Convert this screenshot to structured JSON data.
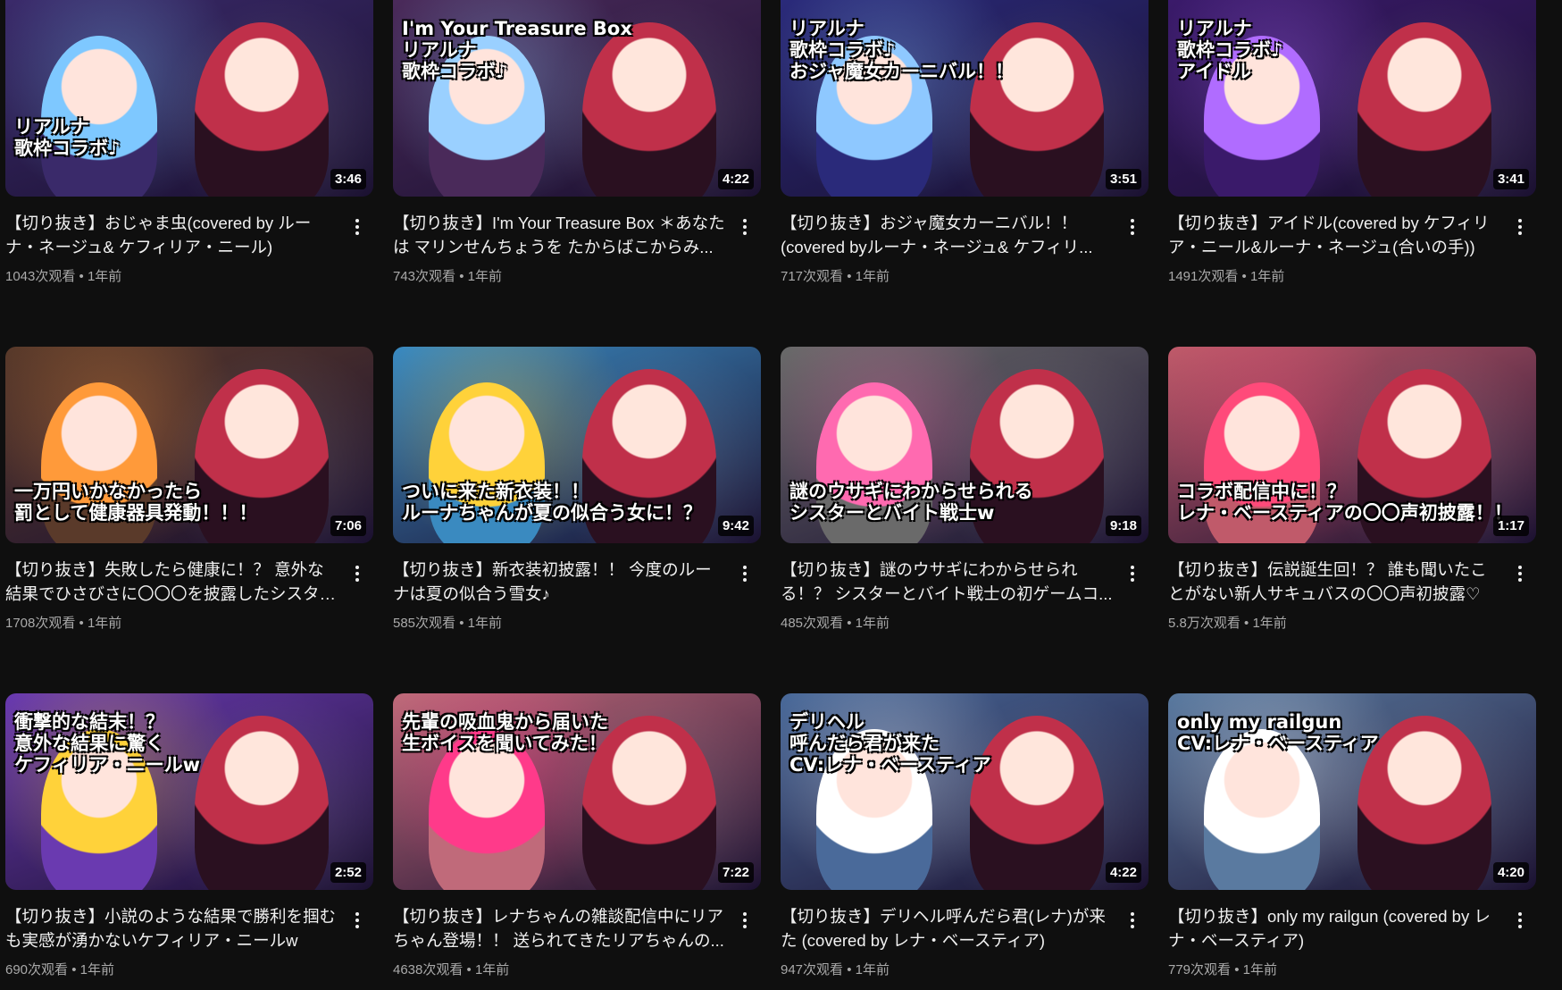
{
  "videos": [
    {
      "title": "【切り抜き】おじゃま虫(covered by ルーナ・ネージュ& ケフィリア・ニール)",
      "stats": "1043次观看 • 1年前",
      "duration": "3:46",
      "caption": "リアルナ\n歌枠コラボ♪",
      "theme": "#3a2a6a",
      "accent": "#7ec8ff"
    },
    {
      "title": "【切り抜き】I'm Your Treasure Box ＊あなたは マリンせんちょうを たからばこからみ...",
      "stats": "743次观看 • 1年前",
      "duration": "4:22",
      "caption": "I'm Your Treasure Box\nリアルナ\n歌枠コラボ♪",
      "theme": "#4a2a5a",
      "accent": "#9ad0ff"
    },
    {
      "title": "【切り抜き】おジャ魔女カーニバル！！(covered byルーナ・ネージュ& ケフィリ...",
      "stats": "717次观看 • 1年前",
      "duration": "3:51",
      "caption": "リアルナ\n歌枠コラボ♪\nおジャ魔女カーニバル！！",
      "theme": "#2a2a7a",
      "accent": "#8ec8ff"
    },
    {
      "title": "【切り抜き】アイドル(covered by ケフィリア・ニール&ルーナ・ネージュ(合いの手))",
      "stats": "1491次观看 • 1年前",
      "duration": "3:41",
      "caption": "リアルナ\n歌枠コラボ♪\nアイドル",
      "theme": "#3a1a6a",
      "accent": "#b06cff"
    },
    {
      "title": "【切り抜き】失敗したら健康に！？ 意外な結果でひさびさに〇〇〇を披露したシスター...",
      "stats": "1708次观看 • 1年前",
      "duration": "7:06",
      "caption": "一万円いかなかったら\n罰として健康器具発動！！！",
      "theme": "#5a3a2a",
      "accent": "#ff9a3a"
    },
    {
      "title": "【切り抜き】新衣装初披露！！ 今度のルーナは夏の似合う雪女♪",
      "stats": "585次观看 • 1年前",
      "duration": "9:42",
      "caption": "ついに来た新衣装！！\nルーナちゃんが夏の似合う女に！？",
      "theme": "#3a8ac0",
      "accent": "#ffd23a"
    },
    {
      "title": "【切り抜き】謎のウサギにわからせられる！？ シスターとバイト戦士の初ゲームコ...",
      "stats": "485次观看 • 1年前",
      "duration": "9:18",
      "caption": "謎のウサギにわからせられる\nシスターとバイト戦士w",
      "theme": "#6a6a6a",
      "accent": "#ff6ab0"
    },
    {
      "title": "【切り抜き】伝説誕生回！？ 誰も聞いたことがない新人サキュバスの〇〇声初披露♡",
      "stats": "5.8万次观看 • 1年前",
      "duration": "1:17",
      "caption": "コラボ配信中に！？\nレナ・ベースティアの〇〇声初披露！！",
      "theme": "#c05a6a",
      "accent": "#ff4a7a"
    },
    {
      "title": "【切り抜き】小説のような結果で勝利を掴むも実感が湧かないケフィリア・ニールw",
      "stats": "690次观看 • 1年前",
      "duration": "2:52",
      "caption": "衝撃的な結末！？\n意外な結果に驚く\nケフィリア・ニールw",
      "theme": "#6a3ab0",
      "accent": "#ffd23a"
    },
    {
      "title": "【切り抜き】レナちゃんの雑談配信中にリアちゃん登場！！ 送られてきたリアちゃんの...",
      "stats": "4638次观看 • 1年前",
      "duration": "7:22",
      "caption": "先輩の吸血鬼から届いた\n生ボイスを聞いてみた！",
      "theme": "#c06a7a",
      "accent": "#ff3a8a"
    },
    {
      "title": "【切り抜き】デリヘル呼んだら君(レナ)が来た (covered by レナ・ベースティア)",
      "stats": "947次观看 • 1年前",
      "duration": "4:22",
      "caption": "デリヘル\n呼んだら君が来た\nCV:レナ・ベースティア",
      "theme": "#4a6a9a",
      "accent": "#ffffff"
    },
    {
      "title": "【切り抜き】only my railgun (covered by レナ・ベースティア)",
      "stats": "779次观看 • 1年前",
      "duration": "4:20",
      "caption": "only my railgun\nCV:レナ・ベースティア",
      "theme": "#5a7aa0",
      "accent": "#ffffff"
    }
  ]
}
